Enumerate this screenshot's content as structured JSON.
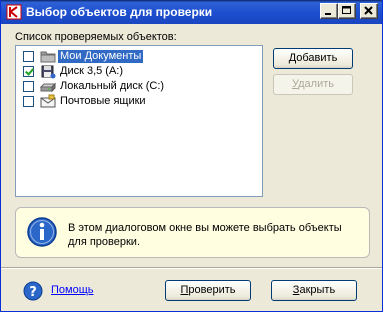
{
  "window": {
    "title": "Выбор объектов для проверки",
    "controls": {
      "minimize": "_",
      "maximize": "□",
      "close": "X"
    }
  },
  "list": {
    "label": "Список проверяемых объектов:",
    "items": [
      {
        "label": "Мои Документы",
        "checked": false,
        "selected": true,
        "icon": "folder-icon"
      },
      {
        "label": "Диск 3,5 (A:)",
        "checked": true,
        "selected": false,
        "icon": "floppy-drive-icon"
      },
      {
        "label": "Локальный диск (C:)",
        "checked": false,
        "selected": false,
        "icon": "hard-drive-icon"
      },
      {
        "label": "Почтовые ящики",
        "checked": false,
        "selected": false,
        "icon": "mailbox-icon"
      }
    ]
  },
  "buttons": {
    "add_first": "Д",
    "add_rest": "обавить",
    "remove_first": "У",
    "remove_rest": "далить",
    "check_first": "П",
    "check_rest": "роверить",
    "close_first": "З",
    "close_rest": "акрыть"
  },
  "info": {
    "text": "В этом диалоговом окне вы можете выбрать объекты для проверки.",
    "icon": "info-icon"
  },
  "footer": {
    "help_label": "Помощь",
    "help_icon": "help-icon"
  },
  "colors": {
    "titlebar": "#1d4fd0",
    "selection": "#316ac5",
    "info_background": "#fffee1",
    "link": "#0000ff"
  }
}
